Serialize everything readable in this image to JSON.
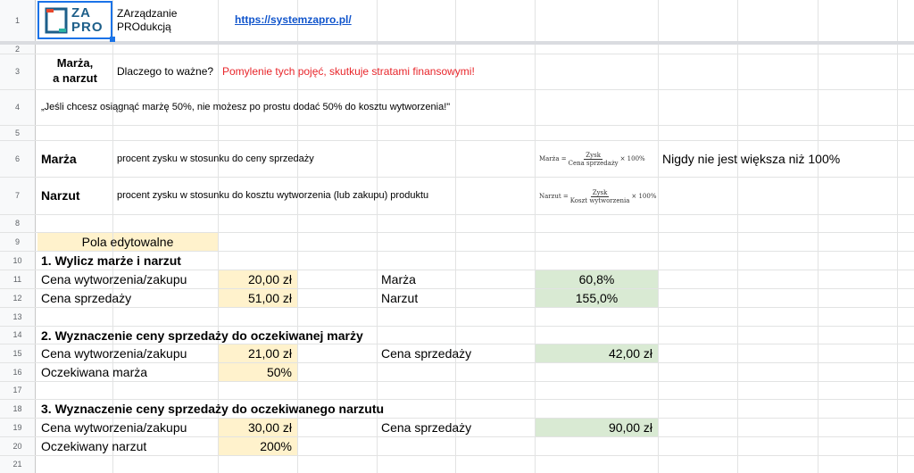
{
  "rows": [
    "1",
    "2",
    "3",
    "4",
    "5",
    "6",
    "7",
    "8",
    "9",
    "10",
    "11",
    "12",
    "13",
    "14",
    "15",
    "16",
    "17",
    "18",
    "19",
    "20",
    "21"
  ],
  "header": {
    "logo_text_top": "ZA",
    "logo_text_bottom": "PRO",
    "app_name_line1": "ZArządzanie",
    "app_name_line2": "PROdukcją",
    "link": "https://systemzapro.pl/"
  },
  "intro": {
    "title_line1": "Marża,",
    "title_line2": "a narzut",
    "question": "Dlaczego to ważne?",
    "warning": "Pomylenie tych pojęć, skutkuje stratami finansowymi!",
    "quote": "„Jeśli chcesz osiągnąć marżę 50%, nie możesz po prostu dodać 50% do kosztu wytworzenia!\""
  },
  "definitions": {
    "marza_label": "Marża",
    "marza_desc": "procent zysku w stosunku do ceny sprzedaży",
    "marza_formula_lhs": "Marża =",
    "marza_formula_num": "Zysk",
    "marza_formula_den": "Cena sprzedaży",
    "marza_formula_mult": "× 100%",
    "marza_note": "Nigdy nie jest większa niż 100%",
    "narzut_label": "Narzut",
    "narzut_desc": "procent zysku w stosunku do kosztu wytworzenia (lub zakupu) produktu",
    "narzut_formula_lhs": "Narzut =",
    "narzut_formula_num": "Zysk",
    "narzut_formula_den": "Koszt wytworzenia",
    "narzut_formula_mult": "× 100%"
  },
  "editable_label": "Pola edytowalne",
  "section1": {
    "title": "1. Wylicz marże i narzut",
    "cost_label": "Cena wytworzenia/zakupu",
    "cost_value": "20,00 zł",
    "price_label": "Cena sprzedaży",
    "price_value": "51,00 zł",
    "marza_label": "Marża",
    "marza_value": "60,8%",
    "narzut_label": "Narzut",
    "narzut_value": "155,0%"
  },
  "section2": {
    "title": "2. Wyznaczenie ceny sprzedaży do oczekiwanej marży",
    "cost_label": "Cena wytworzenia/zakupu",
    "cost_value": "21,00 zł",
    "expected_label": "Oczekiwana marża",
    "expected_value": "50%",
    "result_label": "Cena sprzedaży",
    "result_value": "42,00 zł"
  },
  "section3": {
    "title": "3. Wyznaczenie ceny sprzedaży do oczekiwanego narzutu",
    "cost_label": "Cena wytworzenia/zakupu",
    "cost_value": "30,00 zł",
    "expected_label": "Oczekiwany narzut",
    "expected_value": "200%",
    "result_label": "Cena sprzedaży",
    "result_value": "90,00 zł"
  }
}
